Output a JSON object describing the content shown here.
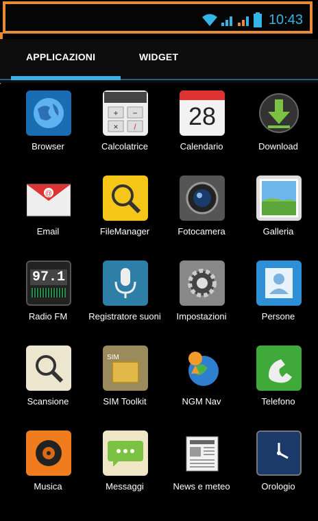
{
  "status_bar": {
    "time": "10:43",
    "icons": [
      "wifi-icon",
      "signal-icon",
      "signal-icon",
      "battery-icon"
    ]
  },
  "tabs": [
    {
      "label": "APPLICAZIONI",
      "selected": true
    },
    {
      "label": "WIDGET",
      "selected": false
    }
  ],
  "apps": [
    {
      "label": "Browser",
      "icon": "browser-globe-icon"
    },
    {
      "label": "Calcolatrice",
      "icon": "calculator-icon"
    },
    {
      "label": "Calendario",
      "icon": "calendar-icon",
      "icon_text": "28"
    },
    {
      "label": "Download",
      "icon": "download-icon"
    },
    {
      "label": "Email",
      "icon": "email-envelope-icon"
    },
    {
      "label": "FileManager",
      "icon": "file-manager-magnifier-icon"
    },
    {
      "label": "Fotocamera",
      "icon": "camera-icon"
    },
    {
      "label": "Galleria",
      "icon": "gallery-landscape-icon"
    },
    {
      "label": "Radio FM",
      "icon": "radio-icon",
      "icon_text": "97.1"
    },
    {
      "label": "Registratore suoni",
      "icon": "microphone-icon"
    },
    {
      "label": "Impostazioni",
      "icon": "settings-gear-icon"
    },
    {
      "label": "Persone",
      "icon": "contacts-person-icon"
    },
    {
      "label": "Scansione",
      "icon": "scan-magnifier-icon"
    },
    {
      "label": "SIM Toolkit",
      "icon": "sim-card-icon",
      "icon_text": "SIM"
    },
    {
      "label": "NGM Nav",
      "icon": "navigation-globe-icon"
    },
    {
      "label": "Telefono",
      "icon": "phone-icon"
    },
    {
      "label": "Musica",
      "icon": "music-speaker-icon"
    },
    {
      "label": "Messaggi",
      "icon": "messages-bubble-icon"
    },
    {
      "label": "News e meteo",
      "icon": "news-newspaper-icon"
    },
    {
      "label": "Orologio",
      "icon": "clock-icon"
    }
  ]
}
